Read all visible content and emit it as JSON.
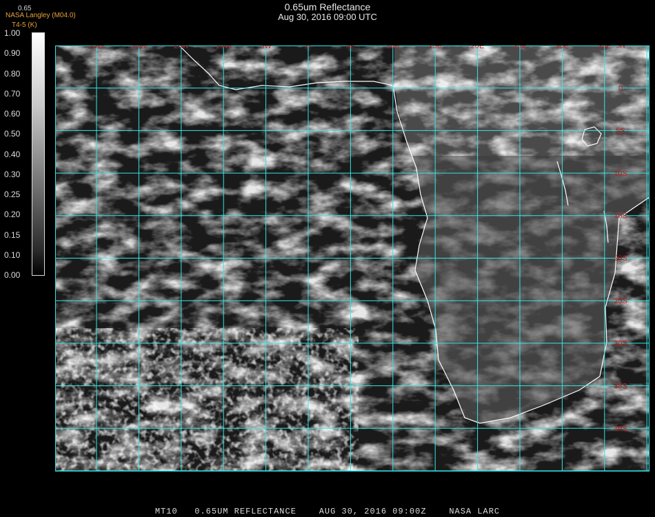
{
  "title": "0.65um Reflectance",
  "timestamp": "Aug 30, 2016 09:00 UTC",
  "source_label": "NASA Langley (M04.0)",
  "product_label": "T4-5 (K)",
  "top_sublabel": "0.65",
  "colorbar": {
    "ticks": [
      "1.00",
      "0.90",
      "0.80",
      "0.70",
      "0.60",
      "0.50",
      "0.40",
      "0.30",
      "0.25",
      "0.20",
      "0.15",
      "0.10",
      "0.00"
    ]
  },
  "map": {
    "lon_labels": [
      "25W",
      "20W",
      "15W",
      "10W",
      "5W",
      "0",
      "5E",
      "10E",
      "15E",
      "20E",
      "25E",
      "30E",
      "35E"
    ],
    "lat_labels": [
      "5N",
      "0",
      "5S",
      "10S",
      "15S",
      "20S",
      "25S",
      "30S",
      "35S",
      "40S"
    ],
    "grid_color": "#33e6e6",
    "label_color": "#c41c1c",
    "coast_color": "#ffffff"
  },
  "footer": "MT10   0.65UM REFLECTANCE    AUG 30, 2016 09:00Z    NASA LARC"
}
